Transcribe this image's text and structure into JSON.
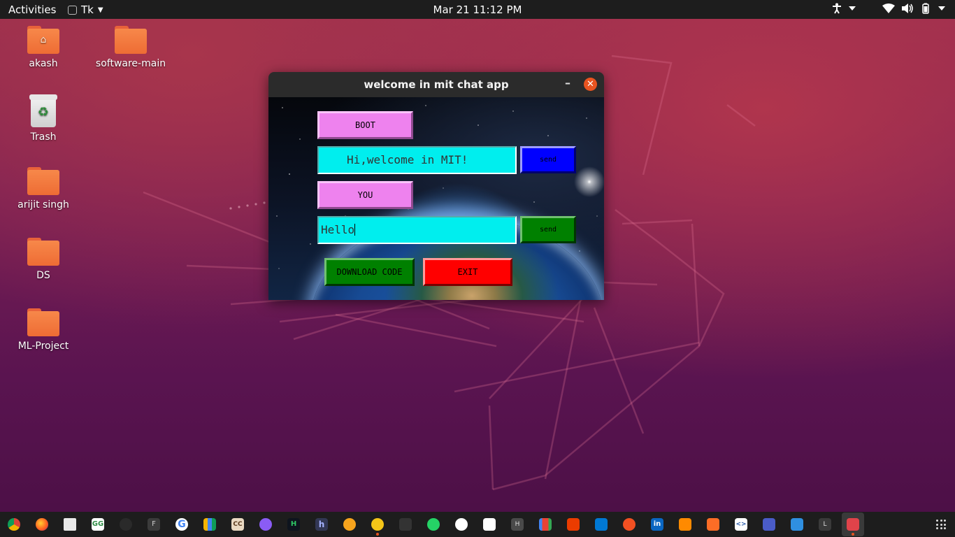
{
  "topbar": {
    "activities": "Activities",
    "app_name": "Tk",
    "clock": "Mar 21  11:12 PM"
  },
  "desktop": {
    "icons": [
      {
        "label": "akash",
        "icon": "home-folder-icon"
      },
      {
        "label": "software-main",
        "icon": "folder-icon"
      },
      {
        "label": "Trash",
        "icon": "trash-icon"
      },
      {
        "label": "arijit singh",
        "icon": "folder-icon"
      },
      {
        "label": "DS",
        "icon": "folder-icon"
      },
      {
        "label": "ML-Project",
        "icon": "folder-icon"
      }
    ]
  },
  "window": {
    "title": "welcome in mit chat app",
    "minimize": "–",
    "close": "✕",
    "boot_label": "BOOT",
    "boot_message": "Hi,welcome in MIT!",
    "send_label_1": "send",
    "you_label": "YOU",
    "user_input": "Hello",
    "send_label_2": "send",
    "download_label": "DOWNLOAD CODE",
    "exit_label": "EXIT"
  },
  "colors": {
    "boot_button": "#ee82ee",
    "entry_bg": "#00eeee",
    "send_1": "#0000ff",
    "send_2": "#008000",
    "download": "#008000",
    "exit": "#ff0000",
    "close_button": "#e95420"
  },
  "taskbar": {
    "icons": [
      "chrome-icon",
      "firefox-icon",
      "files-icon",
      "geeksforgeeks-icon",
      "github-desktop-icon",
      "f-app-icon",
      "google-icon",
      "charts-icon",
      "codechef-icon",
      "mongodb-compass-icon",
      "hackerrank-icon",
      "hackerearth-icon",
      "coding-ninjas-icon",
      "python-icon",
      "pinned-app-icon",
      "whatsapp-icon",
      "github-icon",
      "stocks-icon",
      "h-app-icon",
      "gmail-icon",
      "office-icon",
      "outlook-icon",
      "cloud-icon",
      "linkedin-icon",
      "upload-icon",
      "gitlab-icon",
      "code-editor-icon",
      "cpu-icon",
      "vscode-icon",
      "l-app-icon",
      "screen-recorder-icon"
    ],
    "show_apps": "apps-grid-icon"
  }
}
